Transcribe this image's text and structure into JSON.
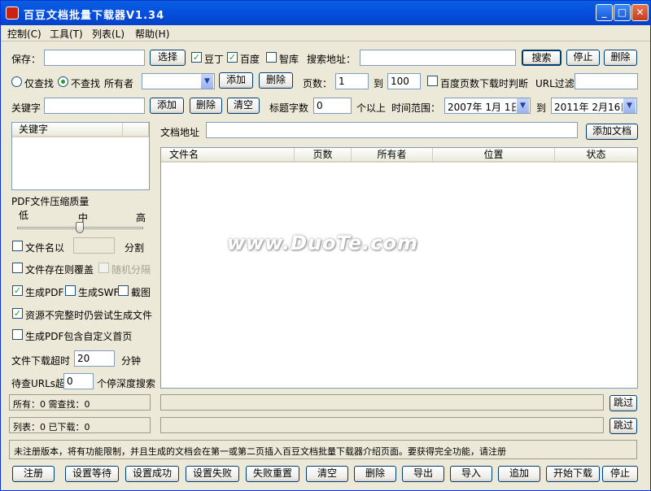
{
  "window": {
    "title": "百豆文档批量下载器V1.34"
  },
  "menu": [
    "控制(C)",
    "工具(T)",
    "列表(L)",
    "帮助(H)"
  ],
  "row1": {
    "save_label": "保存：",
    "choose_btn": "选择",
    "cb_douding": "豆丁",
    "cb_baidu": "百度",
    "cb_zhiku": "智库",
    "search_addr_label": "搜索地址：",
    "search_btn": "搜索",
    "stop_btn": "停止",
    "delete_btn": "删除"
  },
  "row2": {
    "radio_only": "仅查找",
    "radio_no": "不查找",
    "owner_label": "所有者",
    "add_btn": "添加",
    "delete_btn": "删除",
    "pages_label": "页数：",
    "page_from": "1",
    "to_label": "到",
    "page_to": "100",
    "cb_baidu_pages": "百度页数下载时判断",
    "url_filter_label": "URL过滤"
  },
  "row3": {
    "keyword_label": "关键字",
    "add_btn": "添加",
    "delete_btn": "删除",
    "clear_btn": "清空",
    "title_chars_label": "标题字数",
    "title_chars": "0",
    "above_label": "个以上",
    "time_range_label": "时间范围：",
    "date_from": "2007年 1月 1日",
    "to_label": "到",
    "date_to": "2011年 2月16日"
  },
  "left": {
    "keyword_header": "关键字",
    "pdf_quality_label": "PDF文件压缩质量",
    "low": "低",
    "mid": "中",
    "high": "高",
    "cb_filename": "文件名以",
    "split_label": "分割",
    "cb_overwrite": "文件存在则覆盖",
    "cb_random": "随机分隔",
    "cb_gen_pdf": "生成PDF",
    "cb_gen_swf": "生成SWF",
    "cb_screenshot": "截图",
    "cb_retry": "资源不完整时仍尝试生成文件",
    "cb_custom_home": "生成PDF包含自定义首页",
    "timeout_label": "文件下载超时",
    "timeout_value": "20",
    "minutes_label": "分钟",
    "pending_label": "待查URLs超",
    "pending_value": "0",
    "pending_suffix": "个停深度搜索"
  },
  "doc": {
    "addr_label": "文档地址",
    "add_doc_btn": "添加文档",
    "columns": [
      "文件名",
      "页数",
      "所有者",
      "位置",
      "状态"
    ]
  },
  "status": {
    "all_line": "所有：0 需查找：0",
    "list_line": "列表：0 已下载：0",
    "skip1": "跳过",
    "skip2": "跳过"
  },
  "notice": "未注册版本，将有功能限制，并且生成的文档会在第一或第二页插入百豆文档批量下载器介绍页面。要获得完全功能，请注册",
  "bottom_buttons": [
    "注册",
    "设置等待",
    "设置成功",
    "设置失败",
    "失败重置",
    "清空",
    "删除",
    "导出",
    "导入",
    "追加",
    "开始下载",
    "停止"
  ],
  "watermark": "www.DuoTe.com"
}
